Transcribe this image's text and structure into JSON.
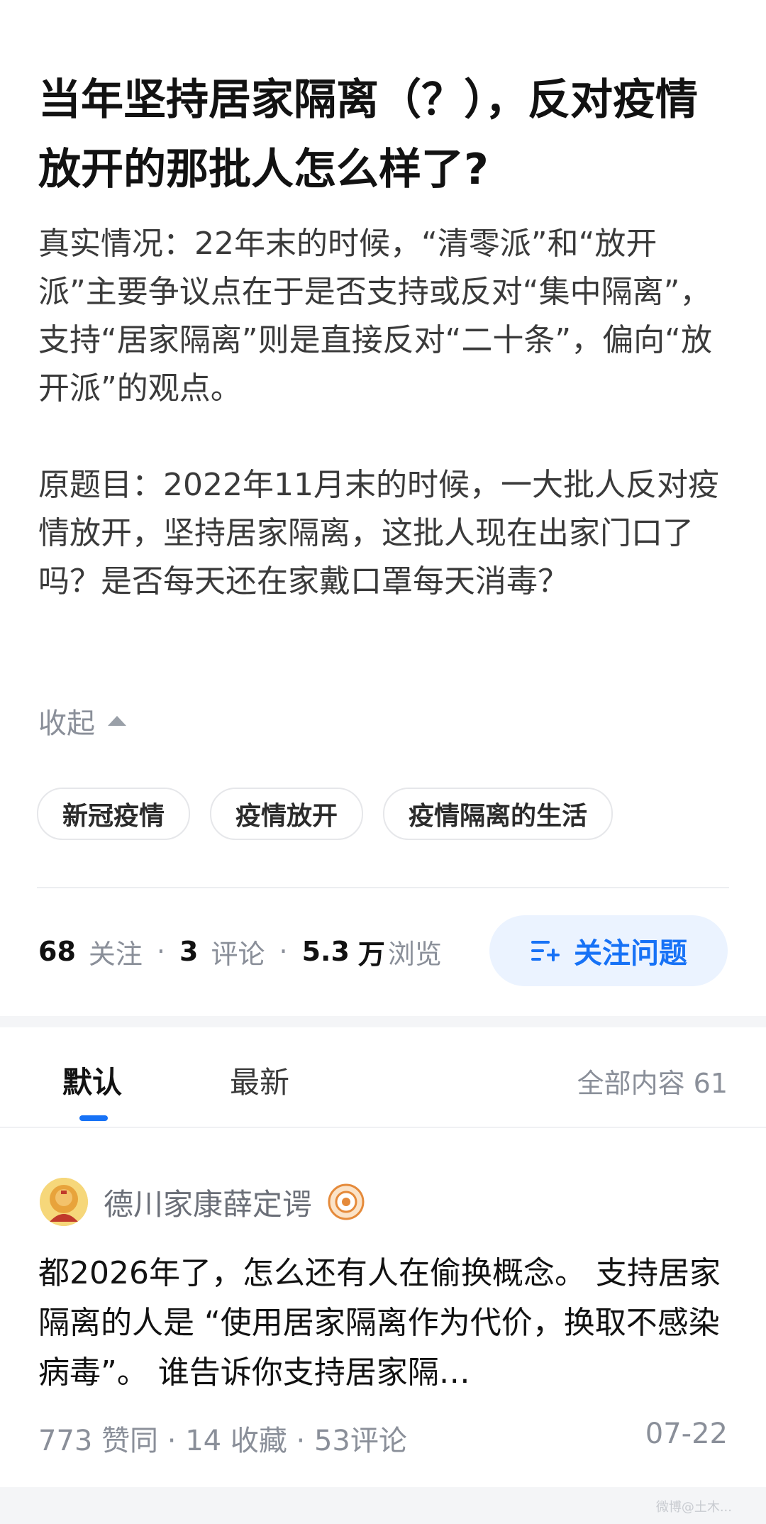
{
  "question": {
    "title": "当年坚持居家隔离（？），反对疫情放开的那批人怎么样了?",
    "detail_paragraphs": [
      "真实情况：22年末的时候，“清零派”和“放开派”主要争议点在于是否支持或反对“集中隔离”，支持“居家隔离”则是直接反对“二十条”，偏向“放开派”的观点。",
      "原题目：2022年11月末的时候，一大批人反对疫情放开，坚持居家隔离，这批人现在出家门口了吗？是否每天还在家戴口罩每天消毒？"
    ],
    "collapse_label": "收起",
    "tags": [
      "新冠疫情",
      "疫情放开",
      "疫情隔离的生活"
    ]
  },
  "stats": {
    "followers_count": "68",
    "followers_label": "关注",
    "comments_count": "3",
    "comments_label": "评论",
    "views_count": "5.3",
    "views_unit": "万",
    "views_label": "浏览",
    "separator": "·"
  },
  "follow_button": {
    "label": "关注问题"
  },
  "tabs": {
    "items": [
      {
        "label": "默认"
      },
      {
        "label": "最新"
      }
    ],
    "total_label": "全部内容 61"
  },
  "answer": {
    "author": "德川家康薛定谔",
    "text": "都2026年了，怎么还有人在偷换概念。 支持居家隔离的人是 “使用居家隔离作为代价，换取不感染病毒”。 谁告诉你支持居家隔…",
    "meta": "773 赞同 · 14 收藏 · 53评论",
    "date": "07-22"
  },
  "icons": {
    "collapse": "triangle-up-icon",
    "follow": "list-plus-icon",
    "badge": "user-badge-icon"
  },
  "colors": {
    "accent": "#1772f6",
    "follow_bg": "#ebf3ff",
    "muted": "#8a8f99"
  },
  "watermark": "微博@土木..."
}
